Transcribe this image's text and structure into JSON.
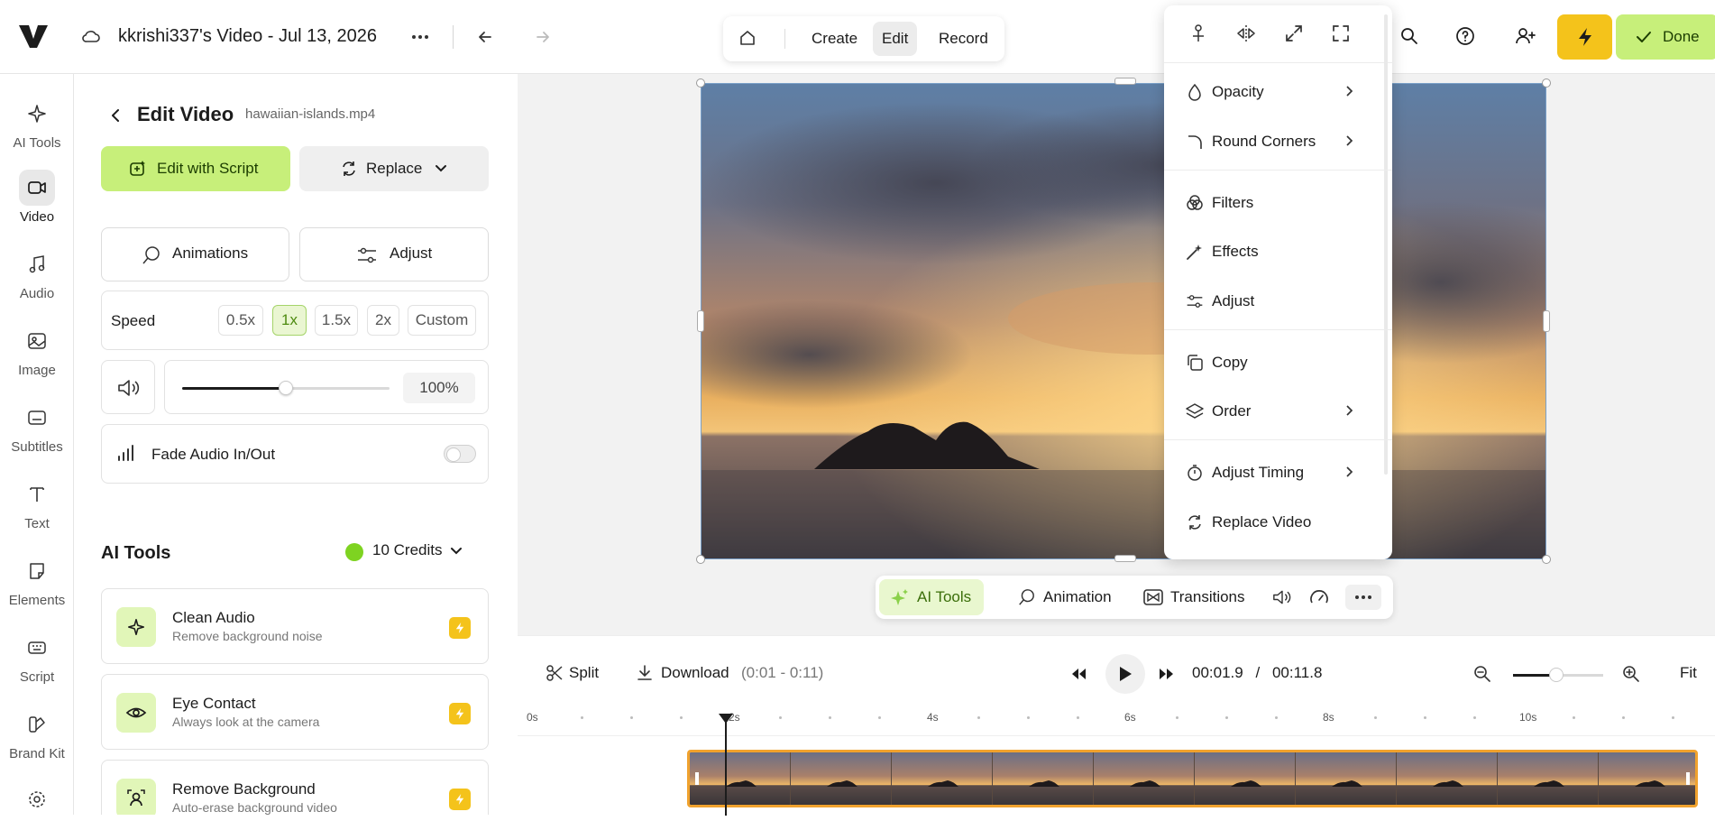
{
  "app": {
    "project_title": "kkrishi337's Video - Jul 13, 2026"
  },
  "modes": {
    "create": "Create",
    "edit": "Edit",
    "record": "Record"
  },
  "header": {
    "done_label": "Done"
  },
  "nav": {
    "items": [
      {
        "label": "AI Tools",
        "icon": "sparkle-icon"
      },
      {
        "label": "Video",
        "icon": "video-camera-icon"
      },
      {
        "label": "Audio",
        "icon": "music-note-icon"
      },
      {
        "label": "Image",
        "icon": "image-icon"
      },
      {
        "label": "Subtitles",
        "icon": "subtitles-icon"
      },
      {
        "label": "Text",
        "icon": "text-icon"
      },
      {
        "label": "Elements",
        "icon": "sticker-icon"
      },
      {
        "label": "Script",
        "icon": "keyboard-icon"
      },
      {
        "label": "Brand Kit",
        "icon": "palette-icon"
      }
    ]
  },
  "panel": {
    "title": "Edit Video",
    "filename": "hawaiian-islands.mp4",
    "edit_with_script": "Edit with Script",
    "replace": "Replace",
    "animations": "Animations",
    "adjust": "Adjust",
    "speed_label": "Speed",
    "speed_options": [
      "0.5x",
      "1x",
      "1.5x",
      "2x",
      "Custom"
    ],
    "speed_selected": "1x",
    "volume_value": "100%",
    "volume_fraction": 0.5,
    "fade_label": "Fade Audio In/Out",
    "fade_enabled": false,
    "ai_tools_heading": "AI Tools",
    "credits": "10 Credits",
    "tools": [
      {
        "name": "Clean Audio",
        "desc": "Remove background noise",
        "icon": "sparkle-icon"
      },
      {
        "name": "Eye Contact",
        "desc": "Always look at the camera",
        "icon": "eye-icon"
      },
      {
        "name": "Remove Background",
        "desc": "Auto-erase background video",
        "icon": "person-scan-icon"
      }
    ]
  },
  "context_menu": {
    "items": [
      {
        "label": "Opacity",
        "icon": "droplet-icon",
        "submenu": true
      },
      {
        "label": "Round Corners",
        "icon": "corner-icon",
        "submenu": true
      },
      {
        "label": "Filters",
        "icon": "filters-icon",
        "submenu": false
      },
      {
        "label": "Effects",
        "icon": "magic-wand-icon",
        "submenu": false
      },
      {
        "label": "Adjust",
        "icon": "sliders-icon",
        "submenu": false
      },
      {
        "label": "Copy",
        "icon": "copy-icon",
        "submenu": false
      },
      {
        "label": "Order",
        "icon": "layers-icon",
        "submenu": true
      },
      {
        "label": "Adjust Timing",
        "icon": "timer-icon",
        "submenu": true
      },
      {
        "label": "Replace Video",
        "icon": "refresh-icon",
        "submenu": false
      }
    ]
  },
  "video_toolbar": {
    "ai_tools": "AI Tools",
    "animation": "Animation",
    "transitions": "Transitions"
  },
  "timeline": {
    "split": "Split",
    "download": "Download",
    "range": "(0:01 - 0:11)",
    "current_time": "00:01.9",
    "separator": "/",
    "total_time": "00:11.8",
    "fit": "Fit",
    "zoom_fraction": 0.48,
    "ruler": [
      "0s",
      "2s",
      "4s",
      "6s",
      "8s",
      "10s"
    ]
  },
  "colors": {
    "accent_green": "#c7ef7a",
    "bolt_yellow": "#f4c31b",
    "clip_border": "#f0a22e"
  }
}
